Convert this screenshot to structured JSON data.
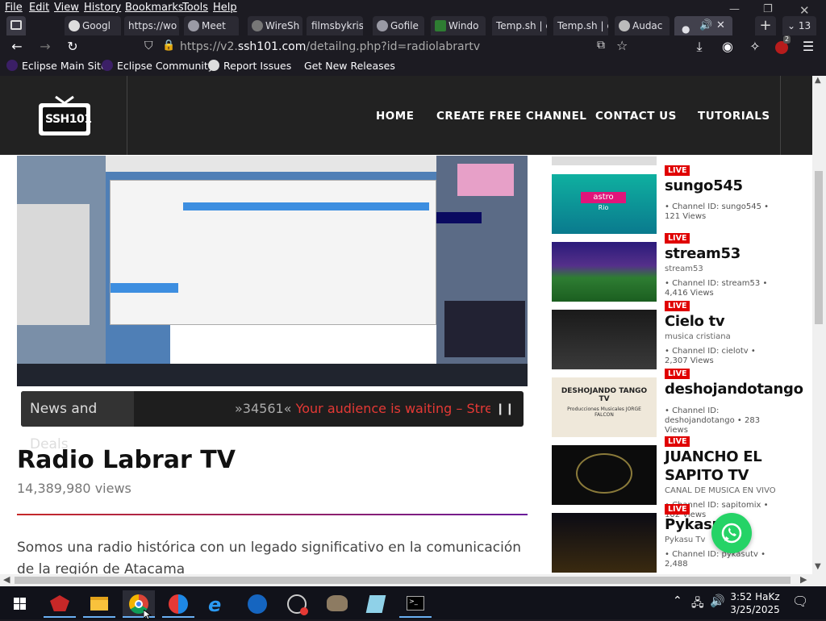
{
  "browser": {
    "menu": [
      "File",
      "Edit",
      "View",
      "History",
      "Bookmarks",
      "Tools",
      "Help"
    ],
    "tabs": [
      {
        "label": "Googl"
      },
      {
        "label": "https://wo"
      },
      {
        "label": "Meet"
      },
      {
        "label": "WireSh"
      },
      {
        "label": "filmsbykris"
      },
      {
        "label": "Gofile"
      },
      {
        "label": "Windo"
      },
      {
        "label": "Temp.sh | e"
      },
      {
        "label": "Temp.sh | e"
      },
      {
        "label": "Audac"
      }
    ],
    "tab_count": "13",
    "url_prefix": "https://v2.",
    "url_domain": "ssh101.com",
    "url_path": "/detailng.php?id=radiolabrartv",
    "extension_badge": "2",
    "bookmarks": [
      "Eclipse Main Site",
      "Eclipse Community",
      "Report Issues",
      "Get New Releases"
    ]
  },
  "site": {
    "logo_text": "SSH101",
    "nav": [
      "HOME",
      "CREATE FREE CHANNEL",
      "CONTACT US",
      "TUTORIALS"
    ]
  },
  "ticker": {
    "label": "News and Deals",
    "prefix": "»34561«",
    "message": "Your audience is waiting – Strea"
  },
  "channel": {
    "title": "Radio Labrar TV",
    "views": "14,389,980 views",
    "description": "Somos una radio histórica con un legado significativo en la comunicación de la región de Atacama"
  },
  "sidebar": [
    {
      "live": "LIVE",
      "title": "sungo545",
      "subtitle": "",
      "meta": "• Channel ID: sungo545  • 121 Views",
      "thumb_text": "astro",
      "thumb_sub": "Rio"
    },
    {
      "live": "LIVE",
      "title": "stream53",
      "subtitle": "stream53",
      "meta": "• Channel ID: stream53  • 4,416 Views"
    },
    {
      "live": "LIVE",
      "title": "Cielo tv",
      "subtitle": "musica cristiana",
      "meta": "• Channel ID: cielotv  • 2,307 Views"
    },
    {
      "live": "LIVE",
      "title": "deshojandotango",
      "subtitle": "",
      "meta": "• Channel ID: deshojandotango  • 283 Views",
      "thumb_text": "DESHOJANDO TANGO TV",
      "thumb_sub": "Producciones Musicales JORGE FALCON"
    },
    {
      "live": "LIVE",
      "title": "JUANCHO EL SAPITO TV",
      "subtitle": "CANAL DE MUSICA EN VIVO",
      "meta": "• Channel ID: sapitomix  • 102 Views"
    },
    {
      "live": "LIVE",
      "title": "Pykasu Tv",
      "subtitle": "Pykasu Tv",
      "meta": "• Channel ID: pykasutv  • 2,488"
    }
  ],
  "taskbar": {
    "time": "3:52 HaKz",
    "date": "3/25/2025"
  },
  "colors": {
    "live_red": "#e00000",
    "accent_divider_start": "#c62828",
    "whatsapp": "#25d366"
  }
}
